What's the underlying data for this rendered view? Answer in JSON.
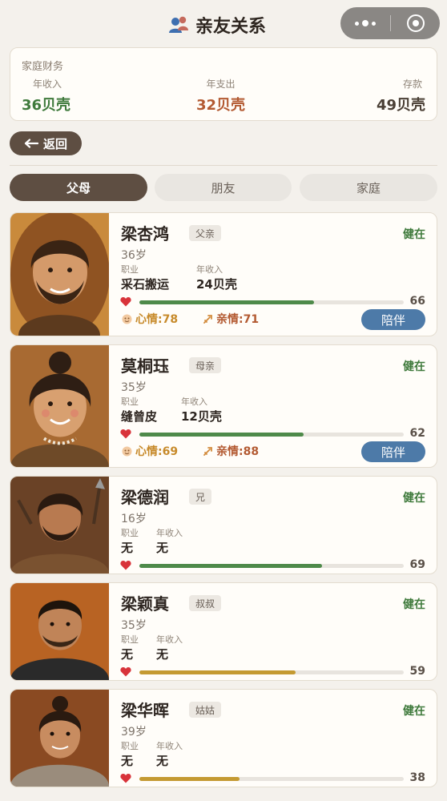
{
  "header": {
    "title": "亲友关系"
  },
  "finance": {
    "title": "家庭财务",
    "income_label": "年收入",
    "income_value": "36贝壳",
    "expense_label": "年支出",
    "expense_value": "32贝壳",
    "saving_label": "存款",
    "saving_value": "49贝壳"
  },
  "back_label": "返回",
  "tabs": [
    {
      "label": "父母",
      "active": true
    },
    {
      "label": "朋友",
      "active": false
    },
    {
      "label": "家庭",
      "active": false
    }
  ],
  "labels": {
    "job": "职业",
    "income": "年收入",
    "accompany": "陪伴"
  },
  "people": [
    {
      "name": "梁杏鸿",
      "relation": "父亲",
      "status": "健在",
      "age": "36岁",
      "job": "采石搬运",
      "income": "24贝壳",
      "bond": 66,
      "bond_color": "#4e8a4a",
      "mood": "心情:78",
      "affection": "亲情:71"
    },
    {
      "name": "莫桐珏",
      "relation": "母亲",
      "status": "健在",
      "age": "35岁",
      "job": "缝曾皮",
      "income": "12贝壳",
      "bond": 62,
      "bond_color": "#4e8a4a",
      "mood": "心情:69",
      "affection": "亲情:88"
    },
    {
      "name": "梁德润",
      "relation": "兄",
      "status": "健在",
      "age": "16岁",
      "job": "无",
      "income": "无",
      "bond": 69,
      "bond_color": "#4e8a4a"
    },
    {
      "name": "梁颖真",
      "relation": "叔叔",
      "status": "健在",
      "age": "35岁",
      "job": "无",
      "income": "无",
      "bond": 59,
      "bond_color": "#c49a32"
    },
    {
      "name": "梁华晖",
      "relation": "姑姑",
      "status": "健在",
      "age": "39岁",
      "job": "无",
      "income": "无",
      "bond": 38,
      "bond_color": "#c49a32"
    }
  ]
}
